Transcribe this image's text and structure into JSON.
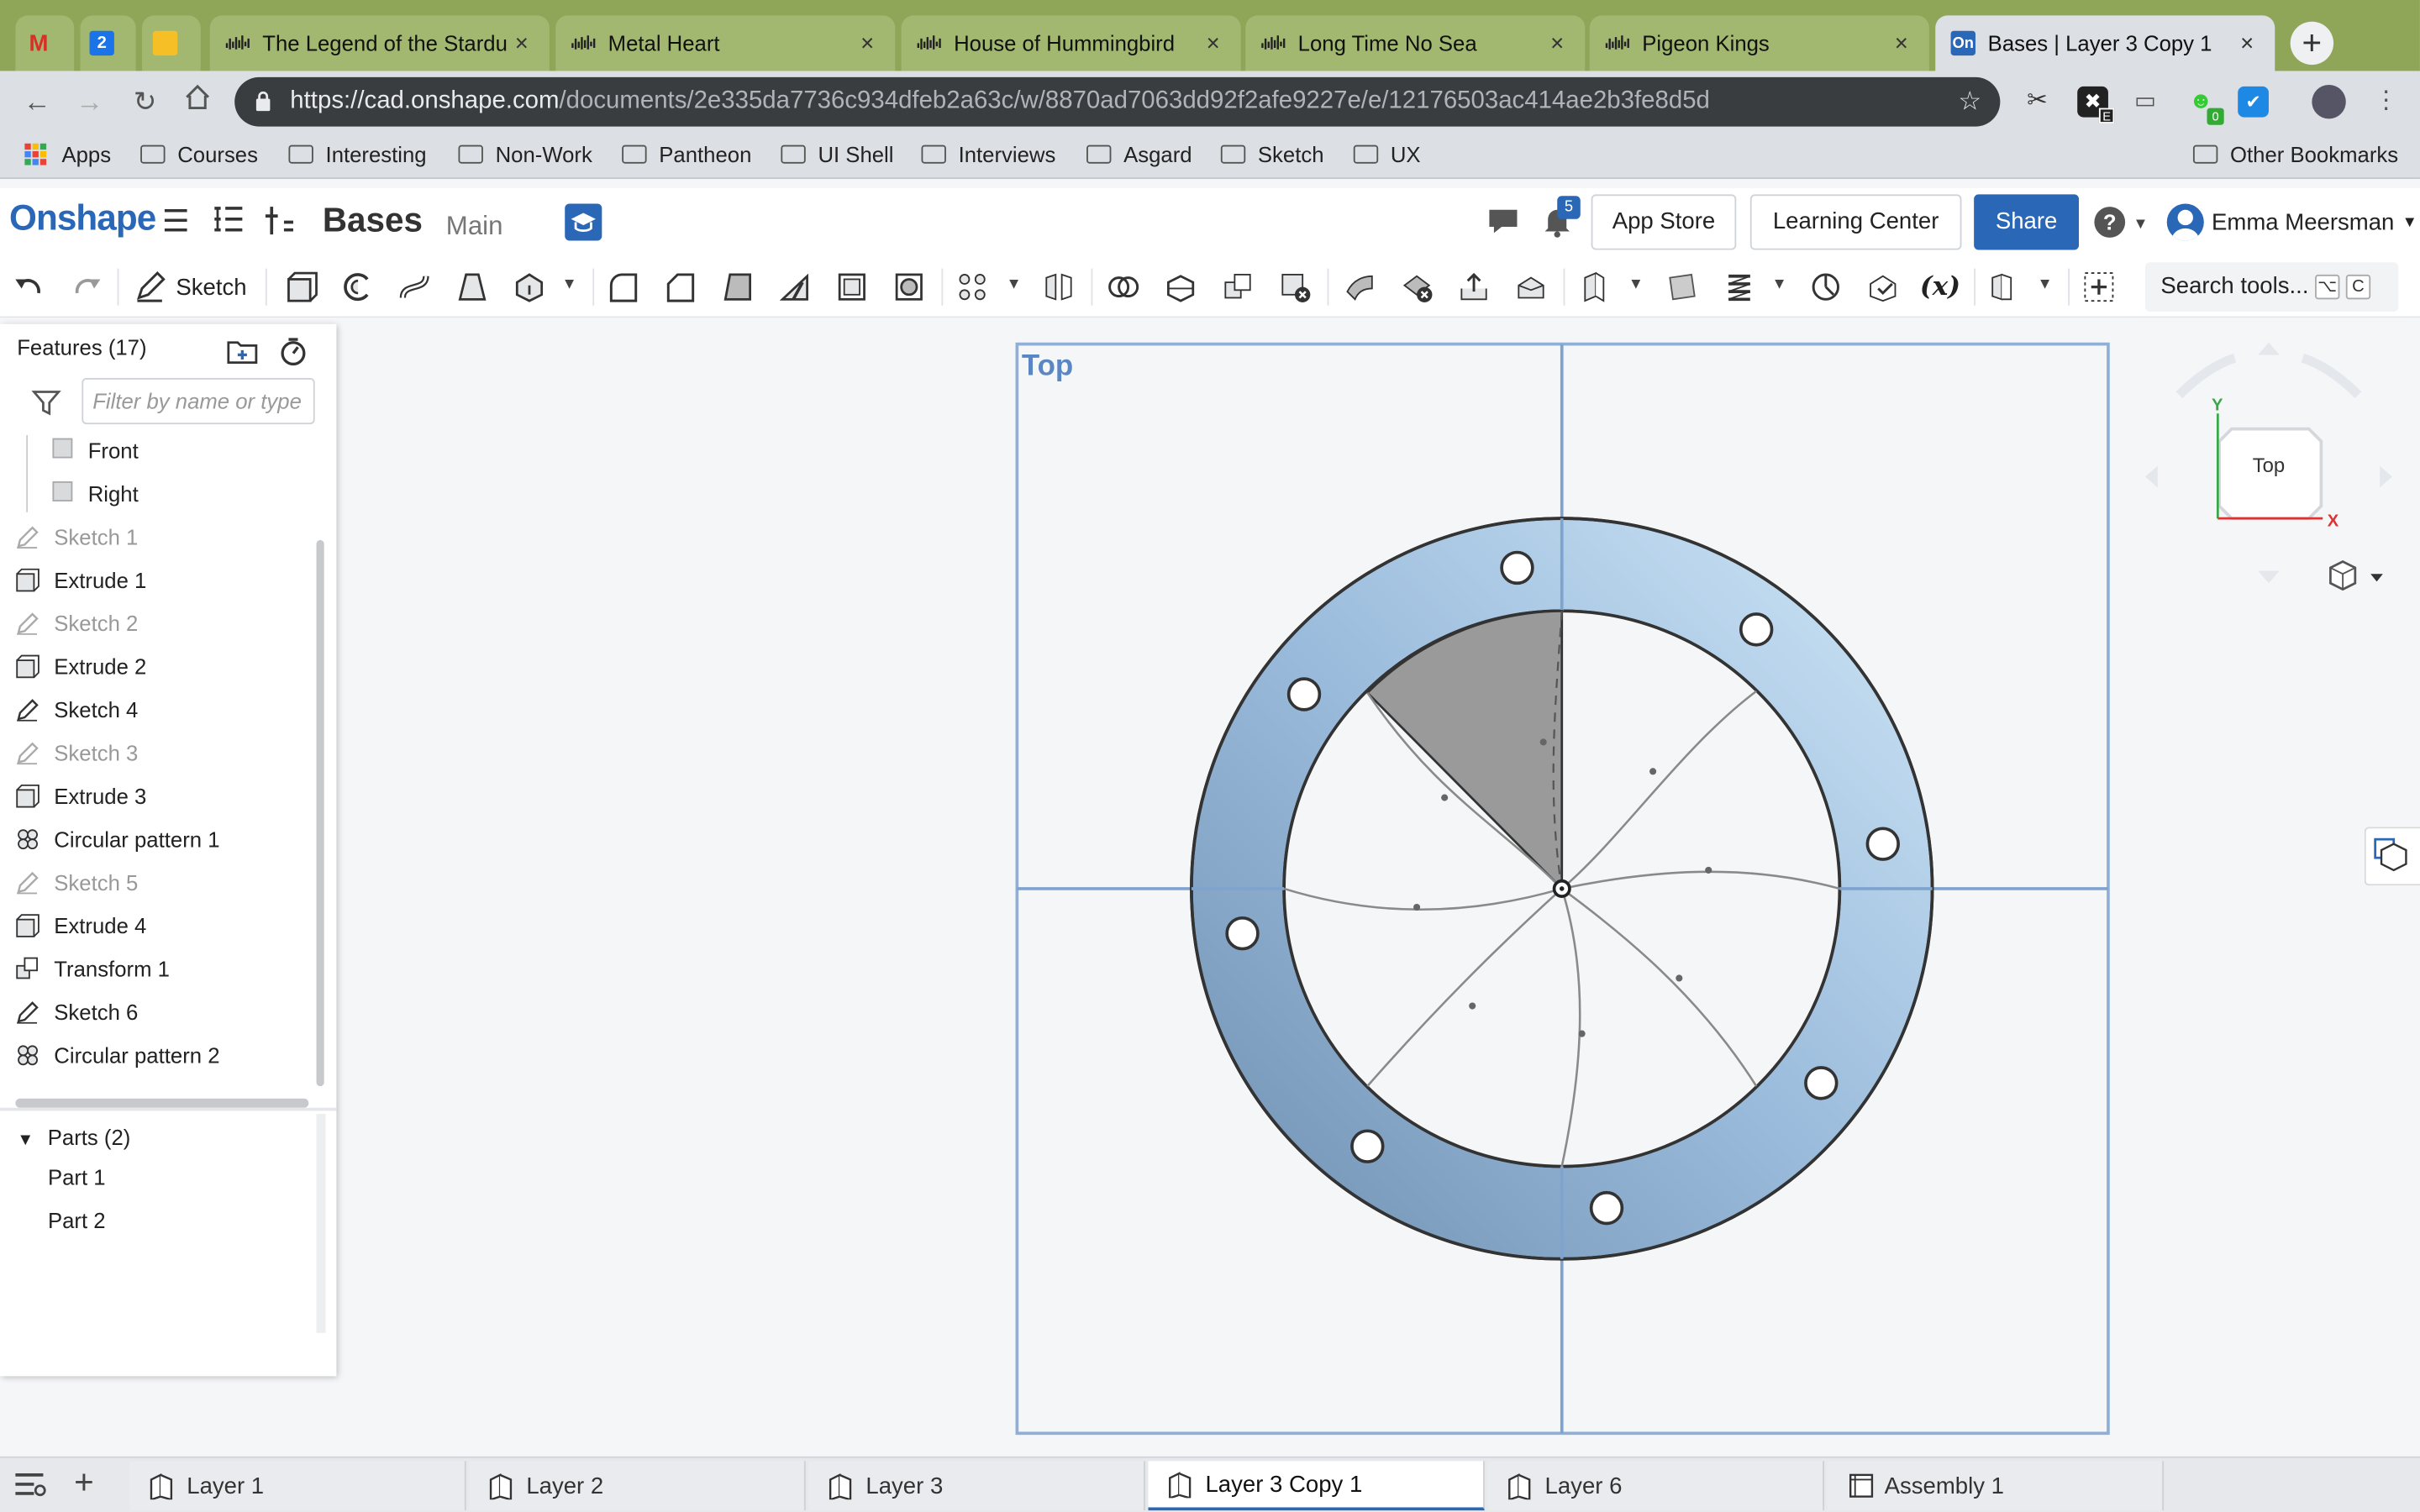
{
  "browser": {
    "pinned_tabs": [
      {
        "icon": "gmail-icon",
        "label": "M"
      },
      {
        "icon": "calendar-icon",
        "label": "2"
      },
      {
        "icon": "keep-icon",
        "label": ""
      }
    ],
    "tabs": [
      {
        "title": "The Legend of the Stardu",
        "icon": "audio-wave-icon"
      },
      {
        "title": "Metal Heart",
        "icon": "audio-wave-icon"
      },
      {
        "title": "House of Hummingbird",
        "icon": "audio-wave-icon"
      },
      {
        "title": "Long Time No Sea",
        "icon": "audio-wave-icon"
      },
      {
        "title": "Pigeon Kings",
        "icon": "audio-wave-icon"
      },
      {
        "title": "Bases | Layer 3 Copy 1",
        "icon": "onshape-icon",
        "favicon_text": "On",
        "active": true
      }
    ],
    "url_host": "https://cad.onshape.com",
    "url_path": "/documents/2e335da7736c934dfeb2a63c/w/8870ad7063dd92f2afe9227e/e/12176503ac414ae2b3fe8d5d",
    "extension_badges": {
      "e_badge": "E",
      "green_badge": "0"
    },
    "bookmarks": [
      "Apps",
      "Courses",
      "Interesting",
      "Non-Work",
      "Pantheon",
      "UI Shell",
      "Interviews",
      "Asgard",
      "Sketch",
      "UX"
    ],
    "other_bookmarks": "Other Bookmarks"
  },
  "app": {
    "logo": "Onshape",
    "doc_name": "Bases",
    "branch": "Main",
    "notifications": "5",
    "app_store": "App Store",
    "learning_center": "Learning Center",
    "share": "Share",
    "help": "?",
    "user": "Emma Meersman",
    "accent": "#2a67b7"
  },
  "toolbar": {
    "sketch_label": "Sketch",
    "search_label": "Search tools...",
    "shortcut_keys": [
      "⌥",
      "C"
    ]
  },
  "features": {
    "title": "Features (17)",
    "filter_placeholder": "Filter by name or type",
    "items": [
      {
        "label": "Front",
        "type": "plane",
        "dim": false
      },
      {
        "label": "Right",
        "type": "plane",
        "dim": false
      },
      {
        "label": "Sketch 1",
        "type": "sketch",
        "dim": true
      },
      {
        "label": "Extrude 1",
        "type": "extrude",
        "dim": false
      },
      {
        "label": "Sketch 2",
        "type": "sketch",
        "dim": true
      },
      {
        "label": "Extrude 2",
        "type": "extrude",
        "dim": false
      },
      {
        "label": "Sketch 4",
        "type": "sketch",
        "dim": false
      },
      {
        "label": "Sketch 3",
        "type": "sketch",
        "dim": true
      },
      {
        "label": "Extrude 3",
        "type": "extrude",
        "dim": false
      },
      {
        "label": "Circular pattern 1",
        "type": "pattern",
        "dim": false
      },
      {
        "label": "Sketch 5",
        "type": "sketch",
        "dim": true
      },
      {
        "label": "Extrude 4",
        "type": "extrude",
        "dim": false
      },
      {
        "label": "Transform 1",
        "type": "transform",
        "dim": false
      },
      {
        "label": "Sketch 6",
        "type": "sketch",
        "dim": false
      },
      {
        "label": "Circular pattern 2",
        "type": "pattern",
        "dim": false
      }
    ],
    "parts_title": "Parts (2)",
    "parts": [
      "Part 1",
      "Part 2"
    ]
  },
  "viewport": {
    "view_label": "Top",
    "cube_label": "Top",
    "axis_x": "X",
    "axis_y": "Y"
  },
  "bottom_tabs": [
    {
      "label": "Layer 1",
      "active": false,
      "kind": "part-studio-icon"
    },
    {
      "label": "Layer 2",
      "active": false,
      "kind": "part-studio-icon"
    },
    {
      "label": "Layer 3",
      "active": false,
      "kind": "part-studio-icon"
    },
    {
      "label": "Layer 3 Copy 1",
      "active": true,
      "kind": "part-studio-icon"
    },
    {
      "label": "Layer 6",
      "active": false,
      "kind": "part-studio-icon"
    },
    {
      "label": "Assembly 1",
      "active": false,
      "kind": "assembly-icon"
    }
  ]
}
